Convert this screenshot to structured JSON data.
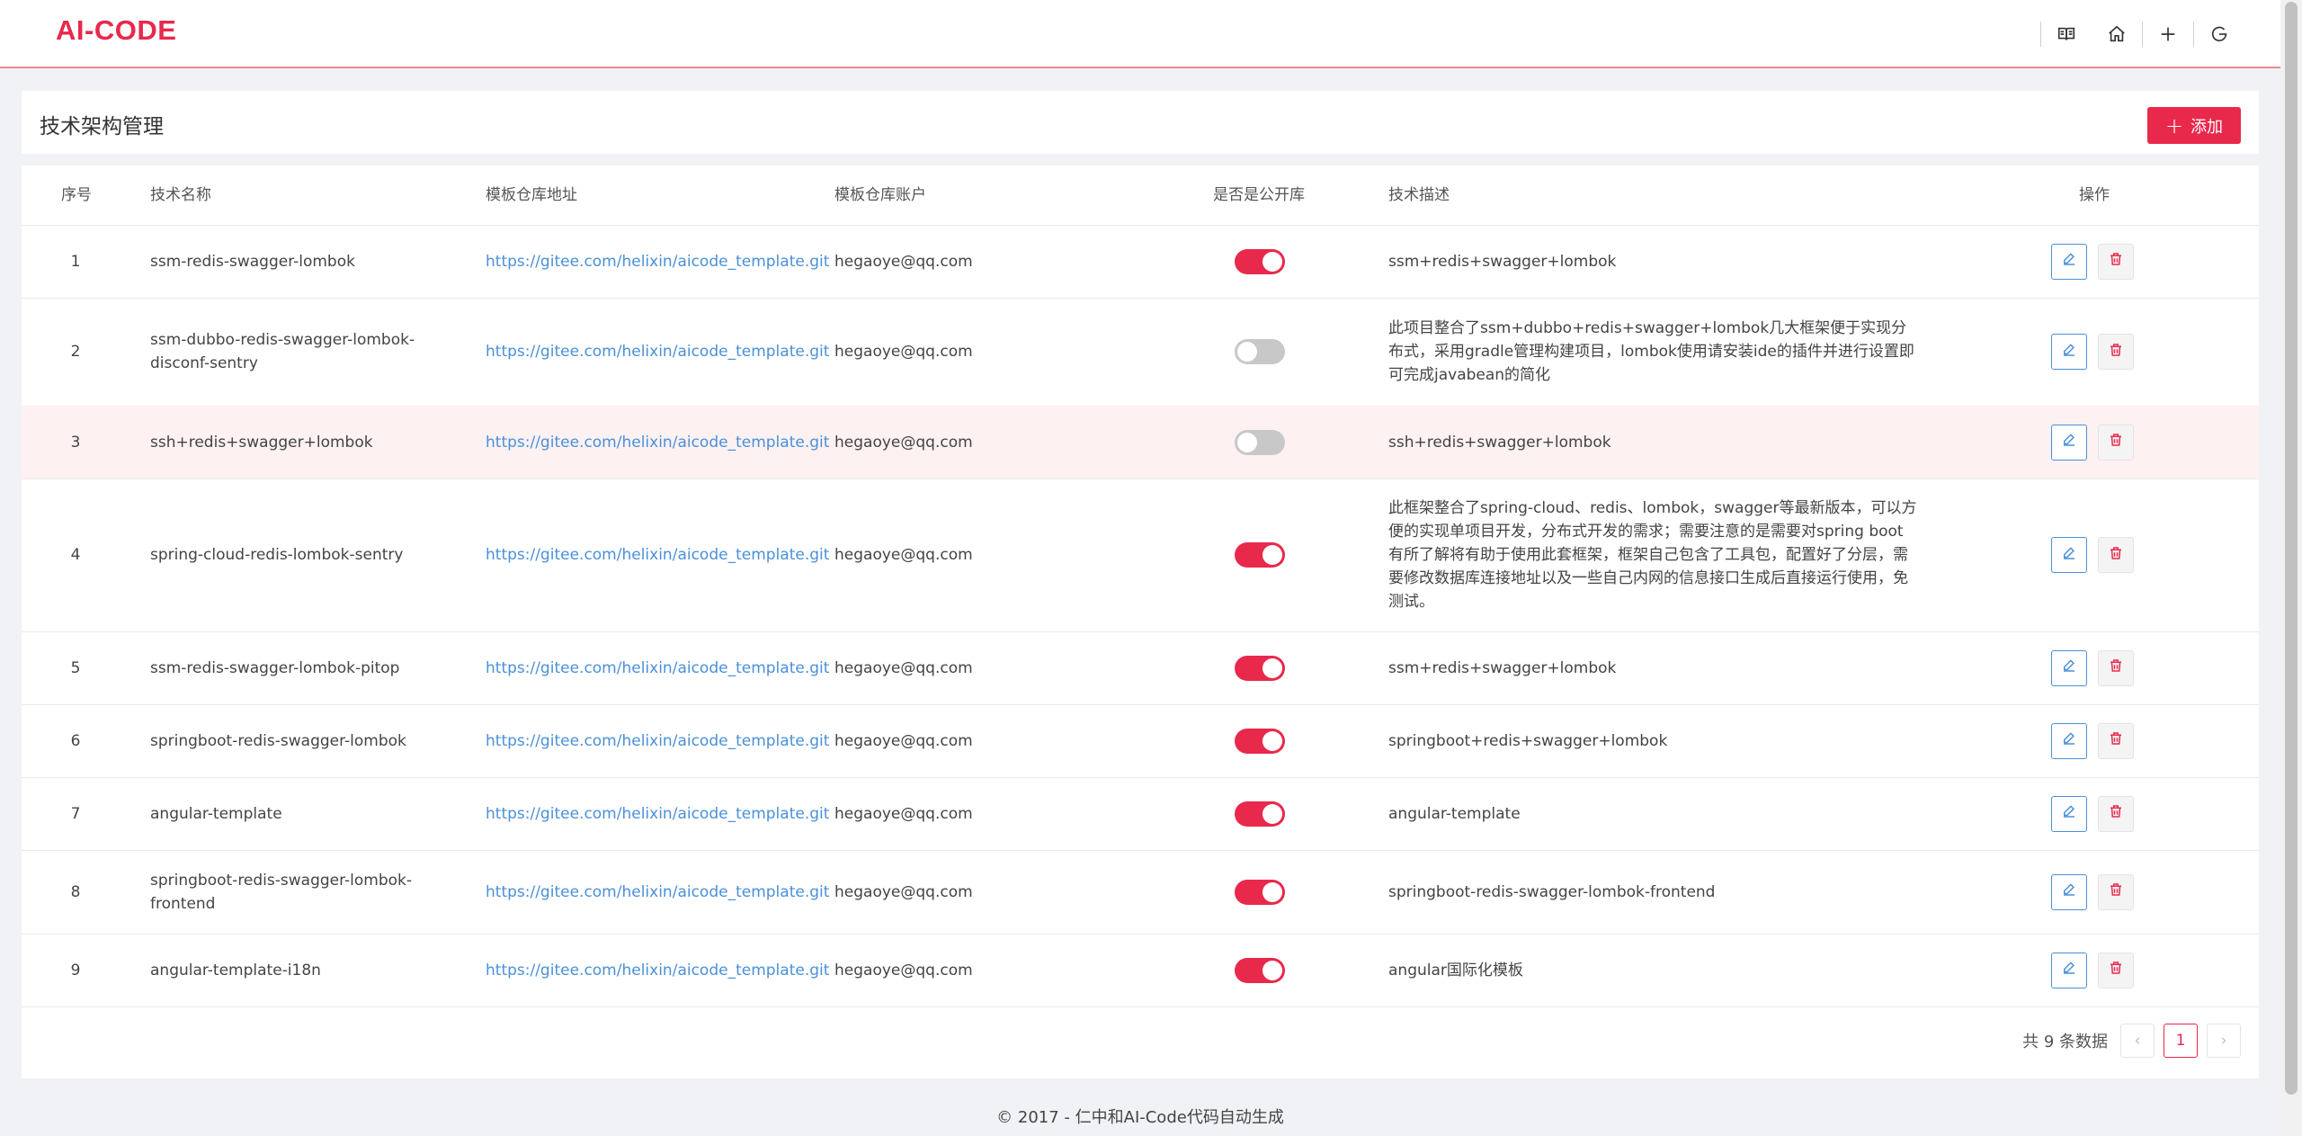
{
  "app": {
    "logo": "AI-CODE"
  },
  "header_icons": [
    "book-icon",
    "home-icon",
    "plus-icon",
    "logout-icon"
  ],
  "page": {
    "title": "技术架构管理",
    "add_label": "添加"
  },
  "table": {
    "columns": {
      "index": "序号",
      "name": "技术名称",
      "repo_url": "模板仓库地址",
      "repo_account": "模板仓库账户",
      "is_public": "是否是公开库",
      "description": "技术描述",
      "actions": "操作"
    },
    "rows": [
      {
        "index": "1",
        "name": "ssm-redis-swagger-lombok",
        "repo_url": "https://gitee.com/helixin/aicode_template.git",
        "account": "hegaoye@qq.com",
        "public": true,
        "desc": "ssm+redis+swagger+lombok"
      },
      {
        "index": "2",
        "name": "ssm-dubbo-redis-swagger-lombok-disconf-sentry",
        "repo_url": "https://gitee.com/helixin/aicode_template.git",
        "account": "hegaoye@qq.com",
        "public": false,
        "desc": "此项目整合了ssm+dubbo+redis+swagger+lombok几大框架便于实现分布式，采用gradle管理构建项目，lombok使用请安装ide的插件并进行设置即可完成javabean的简化"
      },
      {
        "index": "3",
        "name": "ssh+redis+swagger+lombok",
        "repo_url": "https://gitee.com/helixin/aicode_template.git",
        "account": "hegaoye@qq.com",
        "public": false,
        "desc": "ssh+redis+swagger+lombok"
      },
      {
        "index": "4",
        "name": "spring-cloud-redis-lombok-sentry",
        "repo_url": "https://gitee.com/helixin/aicode_template.git",
        "account": "hegaoye@qq.com",
        "public": true,
        "desc": "此框架整合了spring-cloud、redis、lombok，swagger等最新版本，可以方便的实现单项目开发，分布式开发的需求；需要注意的是需要对spring boot有所了解将有助于使用此套框架，框架自己包含了工具包，配置好了分层，需要修改数据库连接地址以及一些自己内网的信息接口生成后直接运行使用，免测试。"
      },
      {
        "index": "5",
        "name": "ssm-redis-swagger-lombok-pitop",
        "repo_url": "https://gitee.com/helixin/aicode_template.git",
        "account": "hegaoye@qq.com",
        "public": true,
        "desc": "ssm+redis+swagger+lombok"
      },
      {
        "index": "6",
        "name": "springboot-redis-swagger-lombok",
        "repo_url": "https://gitee.com/helixin/aicode_template.git",
        "account": "hegaoye@qq.com",
        "public": true,
        "desc": "springboot+redis+swagger+lombok"
      },
      {
        "index": "7",
        "name": "angular-template",
        "repo_url": "https://gitee.com/helixin/aicode_template.git",
        "account": "hegaoye@qq.com",
        "public": true,
        "desc": "angular-template"
      },
      {
        "index": "8",
        "name": "springboot-redis-swagger-lombok-frontend",
        "repo_url": "https://gitee.com/helixin/aicode_template.git",
        "account": "hegaoye@qq.com",
        "public": true,
        "desc": "springboot-redis-swagger-lombok-frontend"
      },
      {
        "index": "9",
        "name": "angular-template-i18n",
        "repo_url": "https://gitee.com/helixin/aicode_template.git",
        "account": "hegaoye@qq.com",
        "public": true,
        "desc": "angular国际化模板"
      }
    ]
  },
  "pagination": {
    "total_text": "共 9 条数据",
    "current_page": "1"
  },
  "footer": {
    "text": "© 2017 - 仁中和AI-Code代码自动生成"
  },
  "colors": {
    "accent": "#e8294c",
    "link": "#4a90d9",
    "highlight_row": "#fdf1f2"
  }
}
